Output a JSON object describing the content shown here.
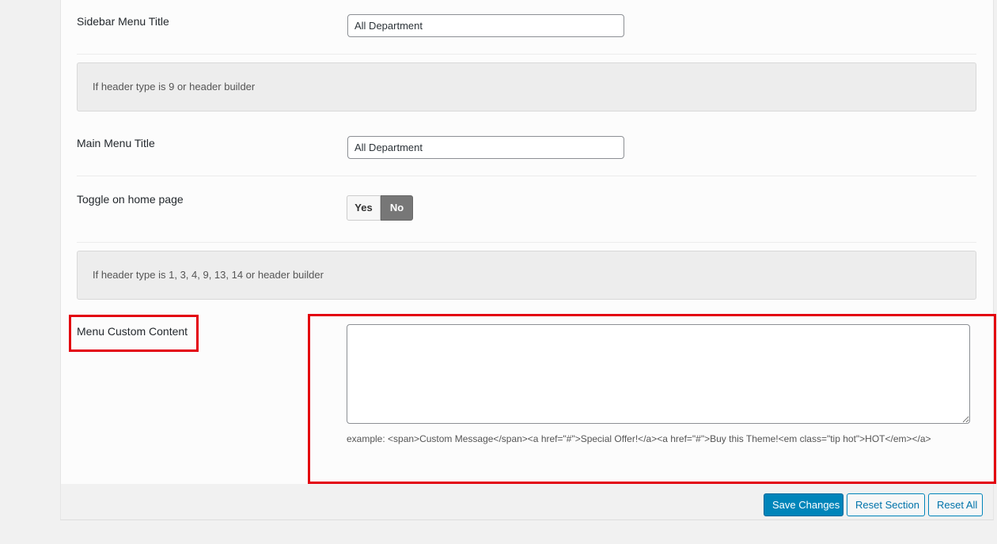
{
  "fields": {
    "sidebar_menu_title": {
      "label": "Sidebar Menu Title",
      "value": "All Department"
    },
    "main_menu_title": {
      "label": "Main Menu Title",
      "value": "All Department"
    },
    "toggle_home": {
      "label": "Toggle on home page",
      "yes": "Yes",
      "no": "No",
      "selected": "No"
    },
    "menu_custom_content": {
      "label": "Menu Custom Content",
      "value": "",
      "example": "example: <span>Custom Message</span><a href=\"#\">Special Offer!</a><a href=\"#\">Buy this Theme!<em class=\"tip hot\">HOT</em></a>"
    }
  },
  "info": {
    "header_9": "If header type is 9 or header builder",
    "header_multi": "If header type is 1, 3, 4, 9, 13, 14 or header builder"
  },
  "footer": {
    "save": "Save Changes",
    "reset_section": "Reset Section",
    "reset_all": "Reset All"
  },
  "colors": {
    "highlight": "#e3000f",
    "primary": "#0085ba"
  }
}
